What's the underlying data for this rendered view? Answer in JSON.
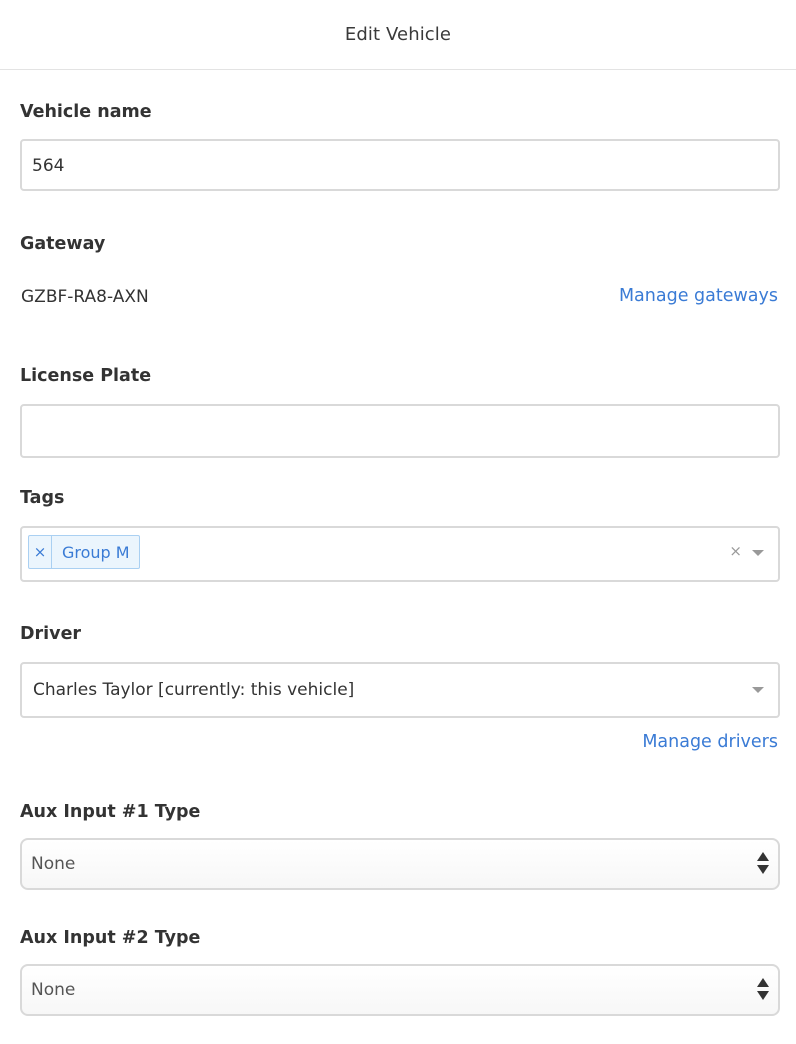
{
  "header": {
    "title": "Edit Vehicle"
  },
  "vehicle_name": {
    "label": "Vehicle name",
    "value": "564"
  },
  "gateway": {
    "label": "Gateway",
    "value": "GZBF-RA8-AXN",
    "manage_link": "Manage gateways"
  },
  "license_plate": {
    "label": "License Plate",
    "value": ""
  },
  "tags": {
    "label": "Tags",
    "items": [
      {
        "label": "Group M",
        "remove_glyph": "×"
      }
    ],
    "clear_glyph": "×"
  },
  "driver": {
    "label": "Driver",
    "value": "Charles Taylor [currently: this vehicle]",
    "manage_link": "Manage drivers"
  },
  "aux1": {
    "label": "Aux Input #1 Type",
    "value": "None"
  },
  "aux2": {
    "label": "Aux Input #2 Type",
    "value": "None"
  },
  "colors": {
    "link": "#3a7bd5",
    "tag_bg": "#ebf5fd",
    "tag_border": "#aad0f2",
    "border": "#d9d9d9"
  }
}
